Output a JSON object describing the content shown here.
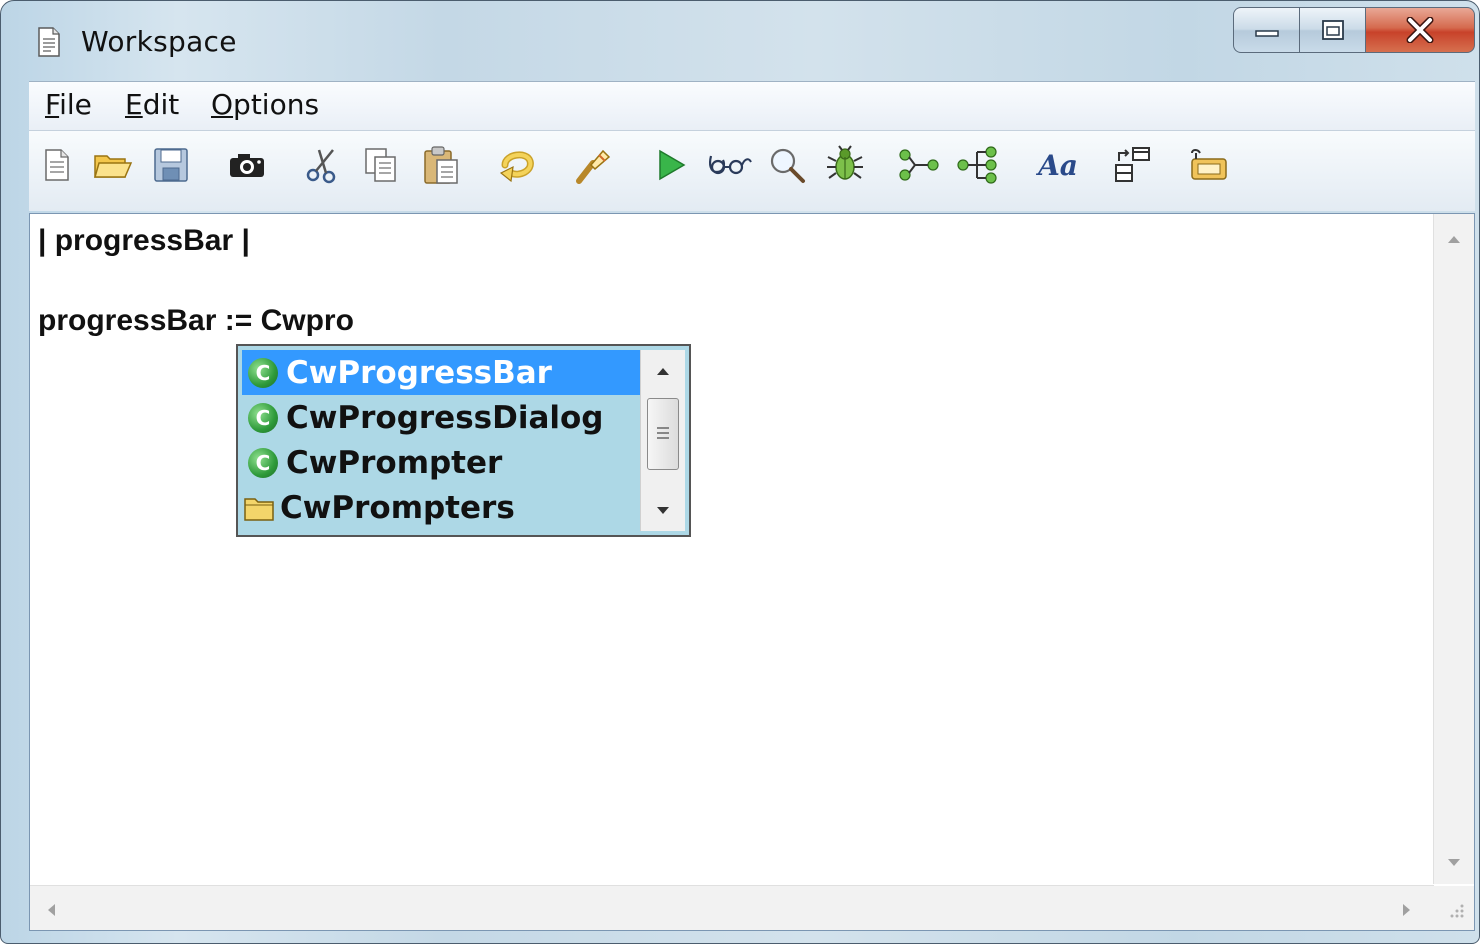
{
  "window": {
    "title": "Workspace"
  },
  "menu": {
    "items": [
      {
        "label_ul": "F",
        "label_rest": "ile"
      },
      {
        "label_ul": "E",
        "label_rest": "dit"
      },
      {
        "label_ul": "O",
        "label_rest": "ptions"
      }
    ]
  },
  "toolbar": {
    "icons": [
      "new-file-icon",
      "open-folder-icon",
      "save-icon",
      "snapshot-camera-icon",
      "cut-icon",
      "copy-icon",
      "paste-icon",
      "undo-icon",
      "redo-icon",
      "run-icon",
      "inspect-glasses-icon",
      "find-magnifier-icon",
      "debug-bug-icon",
      "step-icon",
      "browse-hierarchy-icon",
      "font-icon",
      "layout-icon",
      "tag-icon"
    ],
    "font_label": "Aa"
  },
  "editor": {
    "line1": "| progressBar |",
    "line2": "progressBar := Cwpro"
  },
  "autocomplete": {
    "items": [
      {
        "label": "CwProgressBar",
        "kind": "class",
        "selected": true
      },
      {
        "label": "CwProgressDialog",
        "kind": "class",
        "selected": false
      },
      {
        "label": "CwPrompter",
        "kind": "class",
        "selected": false
      },
      {
        "label": "CwPrompters",
        "kind": "folder",
        "selected": false
      }
    ],
    "class_glyph": "C"
  },
  "colors": {
    "selection": "#3399ff",
    "popup_background": "#add8e6",
    "close_button": "#c8422a"
  }
}
